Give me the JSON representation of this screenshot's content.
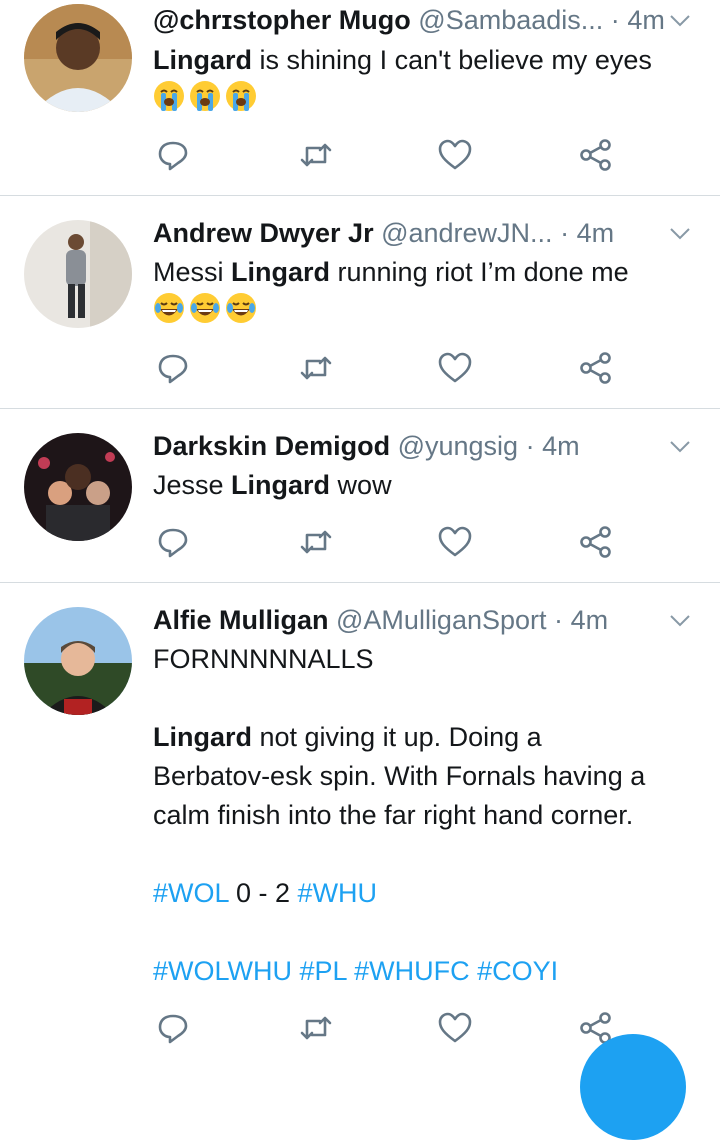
{
  "tweets": [
    {
      "name": "@chrɪstopher Mugo",
      "handle": "@Sambaadis...",
      "dot": "·",
      "time": "4m",
      "lines": [
        [
          {
            "t": "Lingard",
            "k": "b"
          },
          {
            "t": " is shining I can't believe my eyes",
            "k": "n"
          }
        ],
        [
          {
            "emoji": "crying"
          },
          {
            "emoji": "crying"
          },
          {
            "emoji": "crying"
          }
        ]
      ]
    },
    {
      "name": "Andrew Dwyer Jr",
      "handle": "@andrewJN...",
      "dot": "·",
      "time": "4m",
      "lines": [
        [
          {
            "t": "Messi ",
            "k": "n"
          },
          {
            "t": "Lingard",
            "k": "b"
          },
          {
            "t": " running riot I’m done me",
            "k": "n"
          }
        ],
        [
          {
            "emoji": "laughing"
          },
          {
            "emoji": "laughing"
          },
          {
            "emoji": "laughing"
          }
        ]
      ]
    },
    {
      "name": "Darkskin Demigod",
      "handle": "@yungsig",
      "dot": "·",
      "time": "4m",
      "lines": [
        [
          {
            "t": "Jesse ",
            "k": "n"
          },
          {
            "t": "Lingard",
            "k": "b"
          },
          {
            "t": " wow",
            "k": "n"
          }
        ]
      ]
    },
    {
      "name": "Alfie Mulligan",
      "handle": "@AMulliganSport",
      "dot": "·",
      "time": "4m",
      "lines": [
        [
          {
            "t": "FORNNNNNALLS",
            "k": "n"
          }
        ],
        [],
        [
          {
            "t": "Lingard",
            "k": "b"
          },
          {
            "t": " not giving it up. Doing a",
            "k": "n"
          }
        ],
        [
          {
            "t": "Berbatov-esk spin. With Fornals having a",
            "k": "n"
          }
        ],
        [
          {
            "t": "calm finish into the far right hand corner.",
            "k": "n"
          }
        ],
        [],
        [
          {
            "t": "#WOL",
            "k": "tag"
          },
          {
            "t": " 0 - 2 ",
            "k": "n"
          },
          {
            "t": "#WHU",
            "k": "tag"
          }
        ],
        [],
        [
          {
            "t": "#WOLWHU",
            "k": "tag"
          },
          {
            "t": " ",
            "k": "n"
          },
          {
            "t": "#PL",
            "k": "tag"
          },
          {
            "t": " ",
            "k": "n"
          },
          {
            "t": "#WHUFC",
            "k": "tag"
          },
          {
            "t": " ",
            "k": "n"
          },
          {
            "t": "#COYI",
            "k": "tag"
          }
        ]
      ]
    }
  ],
  "icons": {
    "reply": "reply-icon",
    "retweet": "retweet-icon",
    "like": "heart-icon",
    "share": "share-icon",
    "caret": "chevron-down-icon"
  },
  "colors": {
    "accent": "#1da1f2",
    "muted": "#657786",
    "divider": "#d6dce0"
  }
}
